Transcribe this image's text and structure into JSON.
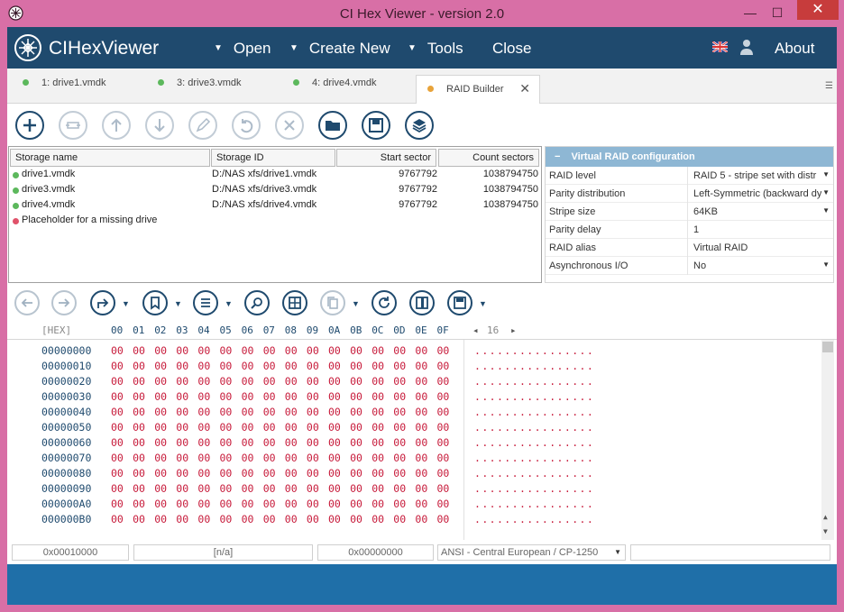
{
  "window": {
    "title": "CI Hex Viewer - version 2.0"
  },
  "menu": {
    "brand": "CIHexViewer",
    "open": "Open",
    "create_new": "Create New",
    "tools": "Tools",
    "close": "Close",
    "about": "About"
  },
  "tabs": [
    {
      "label": "1: drive1.vmdk",
      "dot": "#5cb85c"
    },
    {
      "label": "3: drive3.vmdk",
      "dot": "#5cb85c"
    },
    {
      "label": "4: drive4.vmdk",
      "dot": "#5cb85c"
    },
    {
      "label": "RAID Builder",
      "dot": "#e8a33a"
    }
  ],
  "storage": {
    "headers": {
      "name": "Storage name",
      "id": "Storage ID",
      "start": "Start sector",
      "count": "Count sectors"
    },
    "rows": [
      {
        "name": "drive1.vmdk",
        "id": "D:/NAS xfs/drive1.vmdk",
        "start": "9767792",
        "count": "1038794750",
        "status": "#5cb85c"
      },
      {
        "name": "drive3.vmdk",
        "id": "D:/NAS xfs/drive3.vmdk",
        "start": "9767792",
        "count": "1038794750",
        "status": "#5cb85c"
      },
      {
        "name": "drive4.vmdk",
        "id": "D:/NAS xfs/drive4.vmdk",
        "start": "9767792",
        "count": "1038794750",
        "status": "#5cb85c"
      },
      {
        "name": "Placeholder for a missing drive",
        "id": "",
        "start": "",
        "count": "",
        "status": "#e0526a"
      }
    ]
  },
  "raid": {
    "header": "Virtual RAID configuration",
    "rows": [
      {
        "label": "RAID level",
        "value": "RAID 5 - stripe set with distr"
      },
      {
        "label": "Parity distribution",
        "value": "Left-Symmetric (backward dy"
      },
      {
        "label": "Stripe size",
        "value": "64KB"
      },
      {
        "label": "Parity delay",
        "value": "1"
      },
      {
        "label": "RAID alias",
        "value": "Virtual RAID"
      },
      {
        "label": "Asynchronous I/O",
        "value": "No"
      }
    ]
  },
  "hex": {
    "mode_label": "[HEX]",
    "columns": [
      "00",
      "01",
      "02",
      "03",
      "04",
      "05",
      "06",
      "07",
      "08",
      "09",
      "0A",
      "0B",
      "0C",
      "0D",
      "0E",
      "0F"
    ],
    "width_value": "16",
    "offsets": [
      "00000000",
      "00000010",
      "00000020",
      "00000030",
      "00000040",
      "00000050",
      "00000060",
      "00000070",
      "00000080",
      "00000090",
      "000000A0",
      "000000B0"
    ],
    "byte": "00",
    "ascii_row": "................"
  },
  "status": {
    "offset": "0x00010000",
    "selection": "[n/a]",
    "value": "0x00000000",
    "encoding": "ANSI - Central European / CP-1250"
  },
  "colors": {
    "menubar": "#1f4a6e",
    "accent": "#1f6fa8",
    "hex_bytes": "#c71a3a",
    "window_frame": "#d86fa6"
  }
}
